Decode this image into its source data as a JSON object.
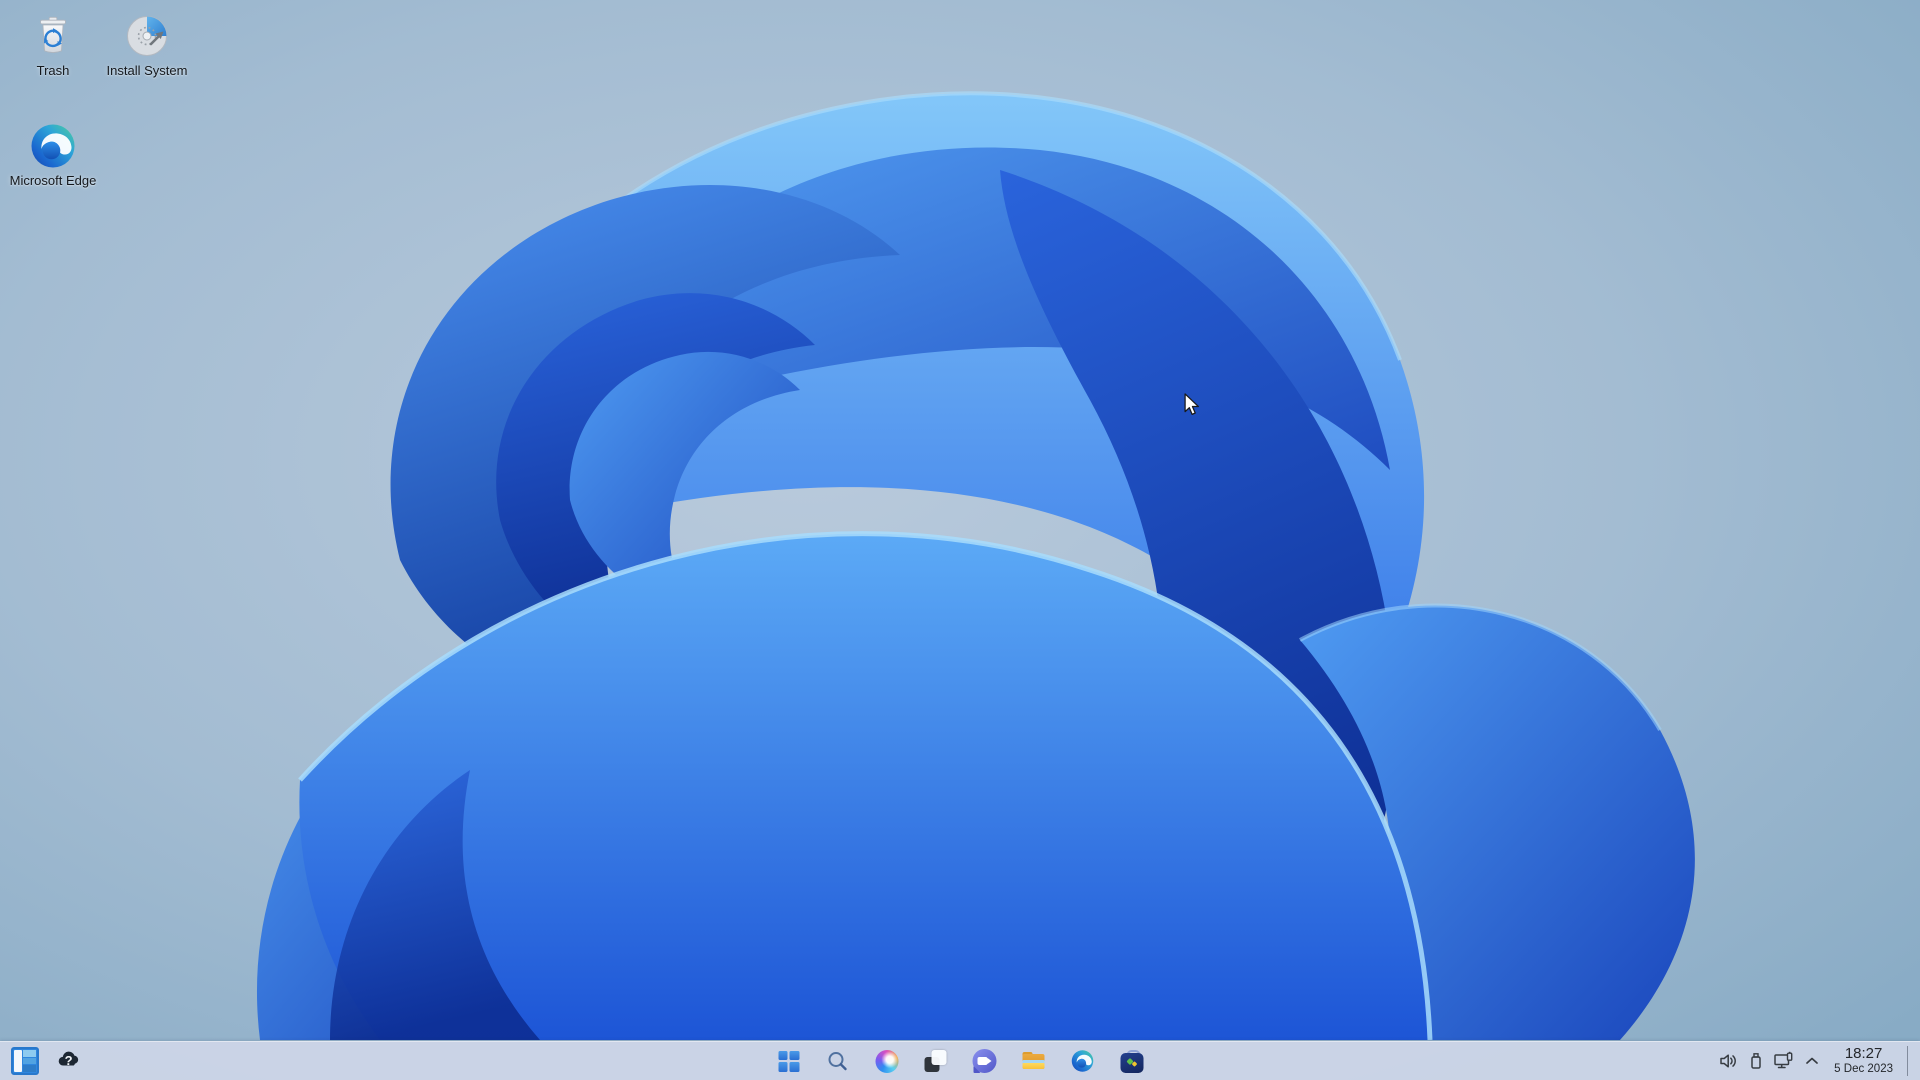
{
  "wallpaper": {
    "name": "windows-11-bloom",
    "colors": {
      "desktop_bg_inner": "#b9cadc",
      "desktop_bg_outer": "#88abc5",
      "bloom_light": "#83c7f9",
      "bloom_mid": "#2e74e8",
      "bloom_dark": "#0b2a8e"
    }
  },
  "desktop_icons": [
    {
      "label": "Trash",
      "icon": "recycle-bin-icon"
    },
    {
      "label": "Install System",
      "icon": "installer-disc-icon"
    },
    {
      "label": "Microsoft Edge",
      "icon": "edge-icon"
    }
  ],
  "taskbar": {
    "color": "#ccd6e7",
    "icon_color": "#3a4046",
    "left_icons": [
      {
        "name": "split-view-panel-icon"
      },
      {
        "name": "weather-widget-icon",
        "glyph": "?"
      }
    ],
    "center_icons": [
      {
        "name": "start-button"
      },
      {
        "name": "search-button"
      },
      {
        "name": "copilot-button"
      },
      {
        "name": "task-view-button"
      },
      {
        "name": "chat-button"
      },
      {
        "name": "file-explorer-button"
      },
      {
        "name": "edge-browser-button"
      },
      {
        "name": "microsoft-store-button"
      }
    ],
    "tray_icons": [
      {
        "name": "volume-icon"
      },
      {
        "name": "usb-device-icon"
      },
      {
        "name": "display-device-icon"
      },
      {
        "name": "expand-tray-chevron"
      }
    ],
    "clock": {
      "time": "18:27",
      "date": "5 Dec 2023"
    }
  }
}
